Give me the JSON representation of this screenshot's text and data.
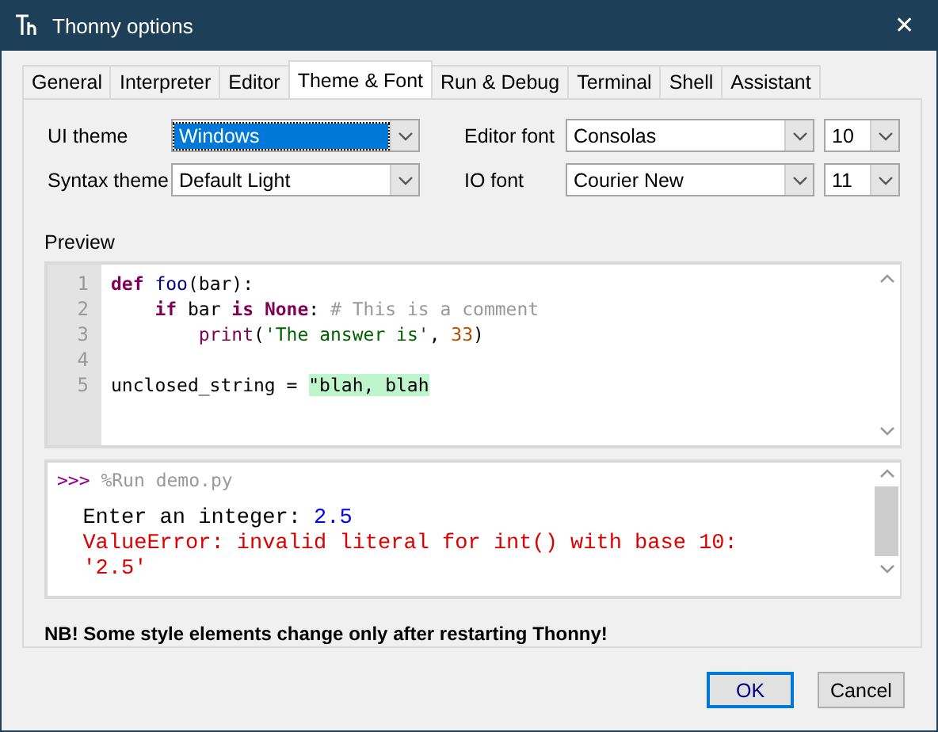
{
  "window": {
    "title": "Thonny options",
    "close": "✕"
  },
  "tabs": [
    {
      "label": "General",
      "selected": false
    },
    {
      "label": "Interpreter",
      "selected": false
    },
    {
      "label": "Editor",
      "selected": false
    },
    {
      "label": "Theme & Font",
      "selected": true
    },
    {
      "label": "Run & Debug",
      "selected": false
    },
    {
      "label": "Terminal",
      "selected": false
    },
    {
      "label": "Shell",
      "selected": false
    },
    {
      "label": "Assistant",
      "selected": false
    }
  ],
  "settings": [
    {
      "label": "UI theme",
      "value": "Windows",
      "focused": true
    },
    {
      "label": "Editor font",
      "value": "Consolas",
      "focused": false,
      "size": "10"
    },
    {
      "label": "Syntax theme",
      "value": "Default Light",
      "focused": false
    },
    {
      "label": "IO font",
      "value": "Courier New",
      "focused": false,
      "size": "11"
    }
  ],
  "preview": {
    "label": "Preview",
    "editor_lines": [
      {
        "number": "1",
        "tokens": [
          {
            "kind": "keyword",
            "text": "def"
          },
          {
            "kind": "definition",
            "text": " foo"
          },
          {
            "kind": "plain",
            "text": "(bar):"
          }
        ]
      },
      {
        "number": "2",
        "tokens": [
          {
            "kind": "keyword",
            "text": "    if"
          },
          {
            "kind": "plain",
            "text": " bar "
          },
          {
            "kind": "keyword",
            "text": "is"
          },
          {
            "kind": "keyword",
            "text": " None"
          },
          {
            "kind": "plain",
            "text": ": "
          },
          {
            "kind": "comment",
            "text": "# This is a comment"
          }
        ]
      },
      {
        "number": "3",
        "tokens": [
          {
            "kind": "builtin",
            "text": "        print"
          },
          {
            "kind": "plain",
            "text": "("
          },
          {
            "kind": "string",
            "text": "'The answer is'"
          },
          {
            "kind": "plain",
            "text": ", "
          },
          {
            "kind": "number",
            "text": "33"
          },
          {
            "kind": "plain",
            "text": ")"
          }
        ]
      },
      {
        "number": "4"
      },
      {
        "number": "5",
        "tokens": [
          {
            "kind": "plain",
            "text": "unclosed_string = "
          },
          {
            "kind": "open_string",
            "text": "\"blah, blah"
          }
        ]
      }
    ],
    "shell_lines": [
      {
        "tokens": [
          {
            "kind": "prompt",
            "text": ">>>"
          },
          {
            "kind": "command",
            "text": " %Run demo.py"
          }
        ]
      },
      {
        "tokens": [
          {
            "kind": "output",
            "text": "  Enter an integer: "
          },
          {
            "kind": "input",
            "text": "2.5"
          }
        ]
      },
      {
        "tokens": [
          {
            "kind": "error",
            "text": "  ValueError: invalid literal for int() with base 10:"
          }
        ]
      },
      {
        "tokens": [
          {
            "kind": "error",
            "text": "  '2.5'"
          }
        ]
      }
    ]
  },
  "note": "NB! Some style elements change only after restarting Thonny!",
  "buttons": [
    {
      "label": "OK",
      "default": true
    },
    {
      "label": "Cancel",
      "default": false
    }
  ]
}
